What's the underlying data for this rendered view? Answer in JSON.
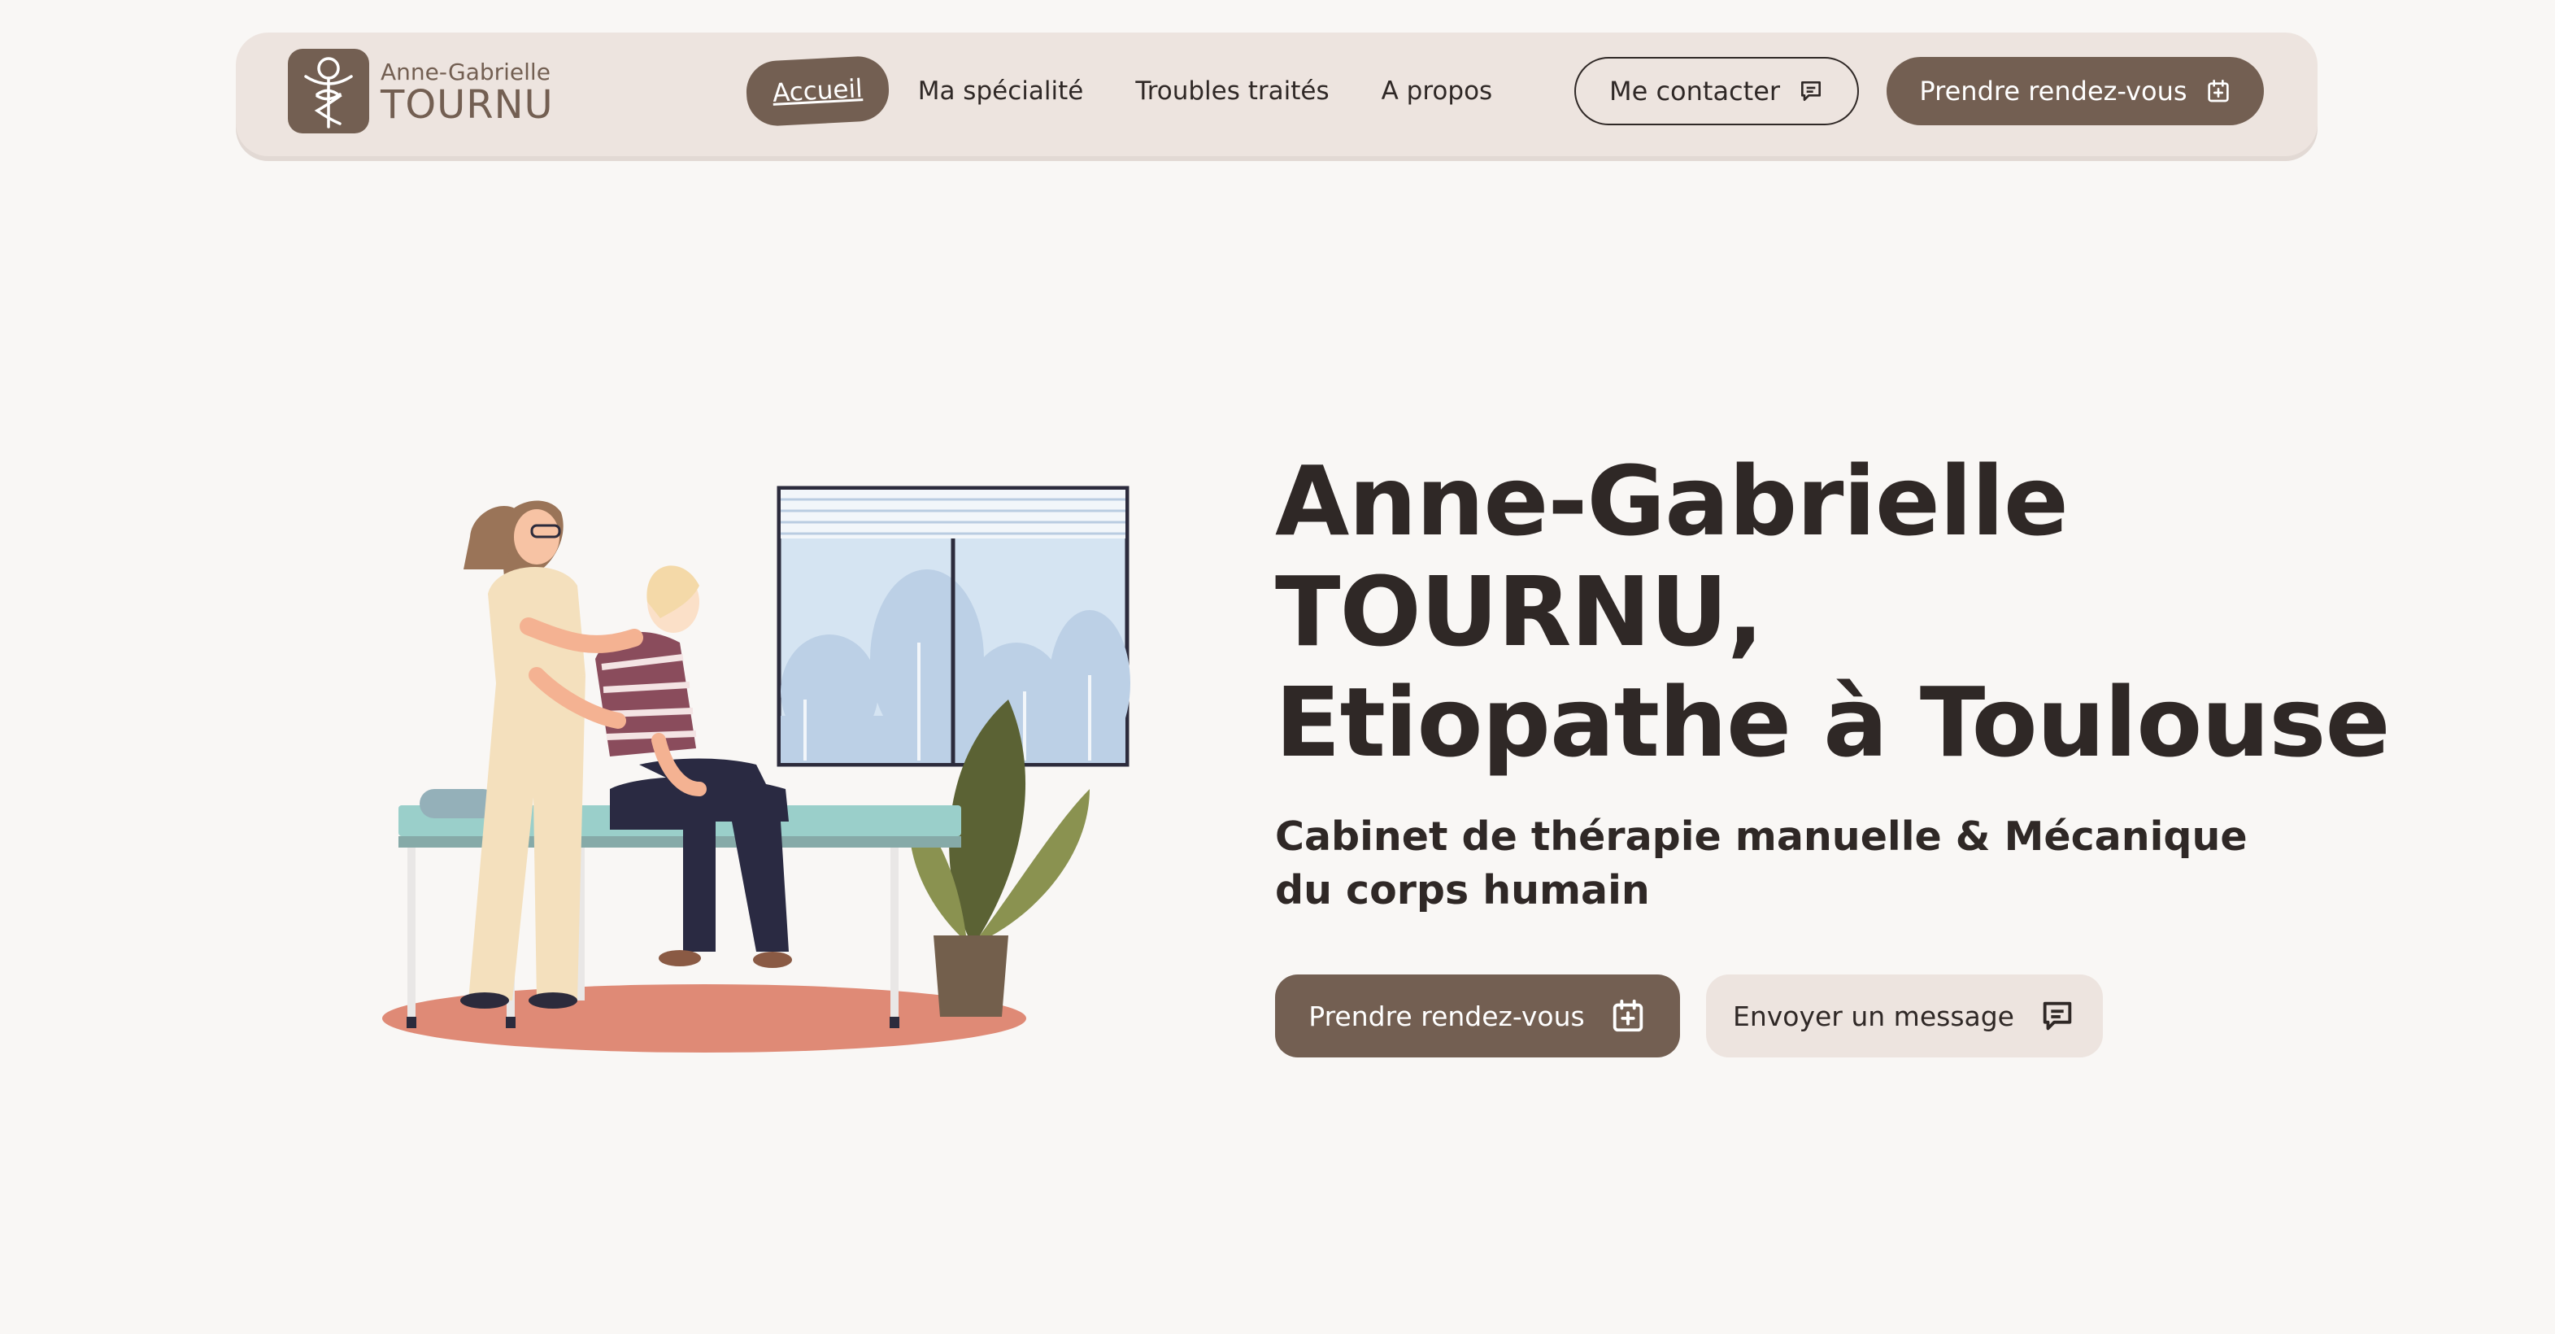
{
  "brand": {
    "first_name": "Anne-Gabrielle",
    "last_name": "TOURNU"
  },
  "nav": {
    "items": [
      {
        "label": "Accueil",
        "active": true
      },
      {
        "label": "Ma spécialité",
        "active": false
      },
      {
        "label": "Troubles traités",
        "active": false
      },
      {
        "label": "A propos",
        "active": false
      }
    ],
    "contact_label": "Me contacter",
    "appointment_label": "Prendre rendez-vous"
  },
  "hero": {
    "title_line1": "Anne-Gabrielle",
    "title_line2": "TOURNU,",
    "title_line3": "Etiopathe à Toulouse",
    "subtitle": "Cabinet de thérapie manuelle & Mécanique du corps humain",
    "cta_primary": "Prendre rendez-vous",
    "cta_secondary": "Envoyer un message"
  },
  "icons": {
    "contact": "message-icon",
    "appointment": "calendar-plus-icon"
  },
  "colors": {
    "accent": "#735f52",
    "nav_bg": "#ede4df",
    "page_bg": "#f9f7f5",
    "text": "#2f2826"
  }
}
